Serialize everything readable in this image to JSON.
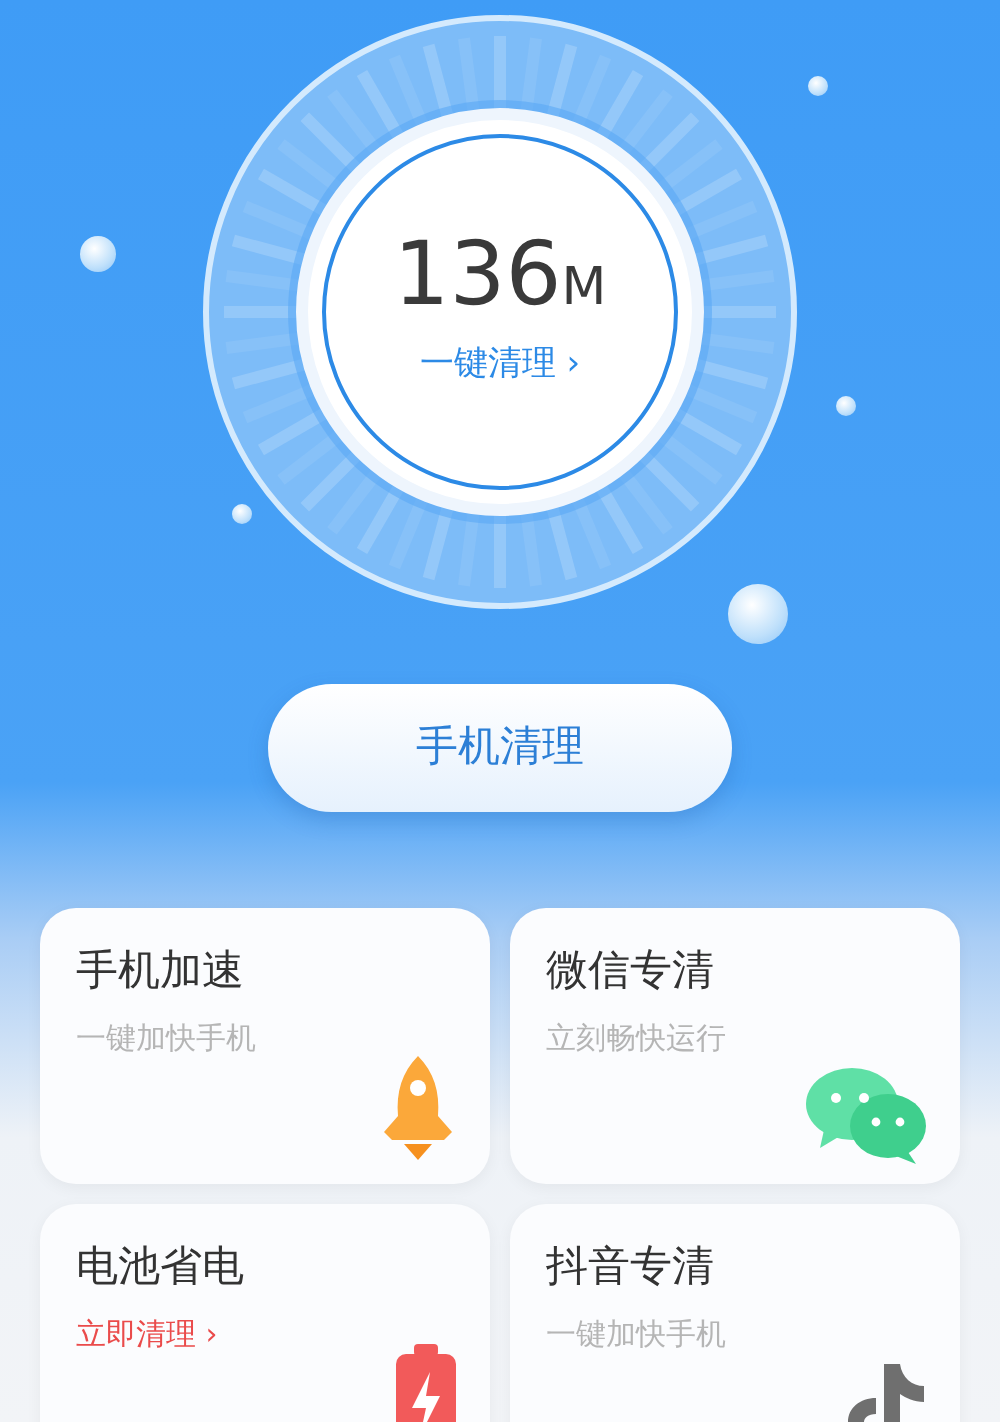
{
  "gauge": {
    "value": "136",
    "unit": "M",
    "action": "一键清理 ›"
  },
  "main_button": {
    "label": "手机清理"
  },
  "cards": [
    {
      "title": "手机加速",
      "subtitle": "一键加快手机",
      "highlight": false,
      "kind": "rocket"
    },
    {
      "title": "微信专清",
      "subtitle": "立刻畅快运行",
      "highlight": false,
      "kind": "chat"
    },
    {
      "title": "电池省电",
      "subtitle": "立即清理 ›",
      "highlight": true,
      "kind": "battery"
    },
    {
      "title": "抖音专清",
      "subtitle": "一键加快手机",
      "highlight": false,
      "kind": "note"
    }
  ]
}
